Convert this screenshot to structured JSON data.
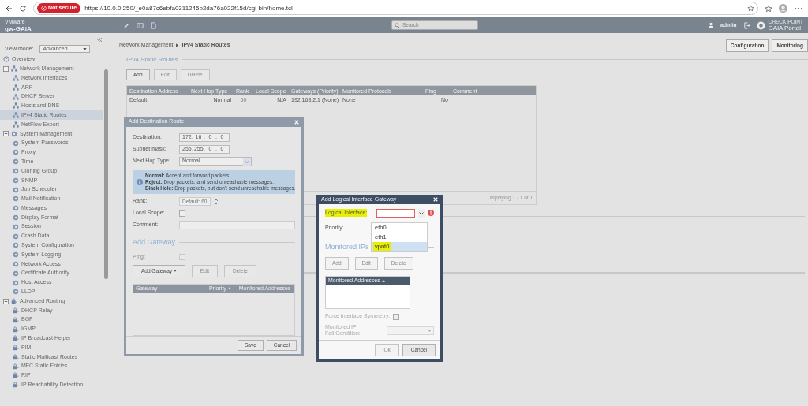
{
  "browser": {
    "security": "Not secure",
    "url": "https://10.0.0.250/_e0a87c6ebfa0311245b2da76a022f15d/cgi-bin/home.tcl"
  },
  "header": {
    "vendor": "VMware",
    "host": "gw-GAiA",
    "search_placeholder": "Search",
    "user": "admin",
    "brand_small": "CHECK POINT",
    "brand": "GAiA Portal"
  },
  "sidebar": {
    "view_mode_label": "View mode:",
    "view_mode": "Advanced",
    "tree": [
      {
        "label": "Overview",
        "kind": "overview",
        "selected": false
      },
      {
        "label": "Network Management",
        "kind": "network",
        "selected": false,
        "expanded": true,
        "children": [
          {
            "label": "Network Interfaces",
            "kind": "network",
            "selected": false
          },
          {
            "label": "ARP",
            "kind": "network",
            "selected": false
          },
          {
            "label": "DHCP Server",
            "kind": "network",
            "selected": false
          },
          {
            "label": "Hosts and DNS",
            "kind": "network",
            "selected": false
          },
          {
            "label": "IPv4 Static Routes",
            "kind": "network",
            "selected": true
          },
          {
            "label": "NetFlow Export",
            "kind": "network",
            "selected": false
          }
        ]
      },
      {
        "label": "System Management",
        "kind": "gear",
        "selected": false,
        "expanded": true,
        "children": [
          {
            "label": "System Passwords",
            "kind": "gear",
            "selected": false
          },
          {
            "label": "Proxy",
            "kind": "gear",
            "selected": false
          },
          {
            "label": "Time",
            "kind": "gear",
            "selected": false
          },
          {
            "label": "Cloning Group",
            "kind": "gear",
            "selected": false
          },
          {
            "label": "SNMP",
            "kind": "gear",
            "selected": false
          },
          {
            "label": "Job Scheduler",
            "kind": "gear",
            "selected": false
          },
          {
            "label": "Mail Notification",
            "kind": "gear",
            "selected": false
          },
          {
            "label": "Messages",
            "kind": "gear",
            "selected": false
          },
          {
            "label": "Display Format",
            "kind": "gear",
            "selected": false
          },
          {
            "label": "Session",
            "kind": "gear",
            "selected": false
          },
          {
            "label": "Crash Data",
            "kind": "gear",
            "selected": false
          },
          {
            "label": "System Configuration",
            "kind": "gear",
            "selected": false
          },
          {
            "label": "System Logging",
            "kind": "gear",
            "selected": false
          },
          {
            "label": "Network Access",
            "kind": "gear",
            "selected": false
          },
          {
            "label": "Certificate Authority",
            "kind": "gear",
            "selected": false
          },
          {
            "label": "Host Access",
            "kind": "gear",
            "selected": false
          },
          {
            "label": "LLDP",
            "kind": "gear",
            "selected": false
          }
        ]
      },
      {
        "label": "Advanced Routing",
        "kind": "routing",
        "selected": false,
        "expanded": true,
        "children": [
          {
            "label": "DHCP Relay",
            "kind": "routing",
            "selected": false
          },
          {
            "label": "BGP",
            "kind": "routing",
            "selected": false
          },
          {
            "label": "IGMP",
            "kind": "routing",
            "selected": false
          },
          {
            "label": "IP Broadcast Helper",
            "kind": "routing",
            "selected": false
          },
          {
            "label": "PIM",
            "kind": "routing",
            "selected": false
          },
          {
            "label": "Static Multicast Routes",
            "kind": "routing",
            "selected": false
          },
          {
            "label": "MFC Static Entries",
            "kind": "routing",
            "selected": false
          },
          {
            "label": "RIP",
            "kind": "routing",
            "selected": false
          },
          {
            "label": "IP Reachability Detection",
            "kind": "routing",
            "selected": false
          }
        ]
      }
    ]
  },
  "main": {
    "breadcrumb": [
      "Network Management",
      "IPv4 Static Routes"
    ],
    "view_buttons": [
      "Configuration",
      "Monitoring"
    ],
    "section_title": "IPv4 Static Routes",
    "toolbar": [
      {
        "label": "Add",
        "disabled": false
      },
      {
        "label": "Edit",
        "disabled": true
      },
      {
        "label": "Delete",
        "disabled": true
      }
    ],
    "table": {
      "columns": [
        "Destination Address",
        "Next Hop Type",
        "Rank",
        "Local Scope",
        "Gateways (Priority)",
        "Monitored Protocols",
        "Ping",
        "Comment"
      ],
      "rows": [
        [
          "Default",
          "Normal",
          "60",
          "N/A",
          "192.168.2.1 (None)",
          "None",
          "No"
        ]
      ]
    },
    "footer": "Displaying 1 - 1 of 1"
  },
  "route_dialog": {
    "title": "Add Destination Route",
    "destination_label": "Destination:",
    "destination": [
      "172",
      "16",
      "0",
      "0"
    ],
    "ip_separator": ".",
    "subnet_label": "Subnet mask:",
    "subnet": [
      "255",
      "255",
      "0",
      "0"
    ],
    "next_hop_label": "Next Hop Type:",
    "next_hop": "Normal",
    "info": [
      "**Normal:** Accept and forward packets.",
      "**Reject:** Drop packets, and send unreachable messages.",
      "**Black Hole:** Drop packets, but don't send unreachable messages."
    ],
    "rank_label": "Rank:",
    "rank_placeholder": "Default: 60",
    "local_scope_label": "Local Scope:",
    "local_scope_checked": false,
    "comment_label": "Comment:",
    "gateway_section": "Add Gateway",
    "ping_label": "Ping:",
    "ping_disabled": true,
    "ping_checked": false,
    "gateway_buttons": [
      {
        "label": "Add Gateway",
        "kind": "menu",
        "disabled": false
      },
      {
        "label": "Edit",
        "kind": "plain",
        "disabled": true
      },
      {
        "label": "Delete",
        "kind": "plain",
        "disabled": true
      }
    ],
    "gateway_columns": [
      {
        "label": "Gateway",
        "sorted": false
      },
      {
        "label": "Priority",
        "sorted": true
      },
      {
        "label": "Monitored Addresses",
        "sorted": false
      }
    ],
    "buttons": [
      {
        "label": "Save",
        "disabled": false
      },
      {
        "label": "Cancel",
        "disabled": false
      }
    ]
  },
  "interface_dialog": {
    "title": "Add Logical Interface Gateway",
    "interface_label": "Logical Interface:",
    "interface_label_highlighted": true,
    "interface_invalid": true,
    "options": [
      {
        "label": "eth0",
        "selected": false,
        "highlighted": false
      },
      {
        "label": "eth1",
        "selected": false,
        "highlighted": false
      },
      {
        "label": "vpnt0",
        "selected": true,
        "highlighted": true
      }
    ],
    "priority_label": "Priority:",
    "section": "Monitored IPs",
    "buttons": [
      {
        "label": "Add",
        "disabled": true
      },
      {
        "label": "Edit",
        "disabled": true
      },
      {
        "label": "Delete",
        "disabled": true
      }
    ],
    "columns": [
      {
        "label": "Monitored Addresses",
        "sorted": true
      }
    ],
    "symmetry_label": "Force Interface Symmetry:",
    "symmetry_checked": false,
    "fail_label": "Monitored IP Fail Condition:",
    "advanced_disabled": true,
    "footer_buttons": [
      {
        "label": "Ok",
        "disabled": true
      },
      {
        "label": "Cancel",
        "disabled": false
      }
    ]
  }
}
